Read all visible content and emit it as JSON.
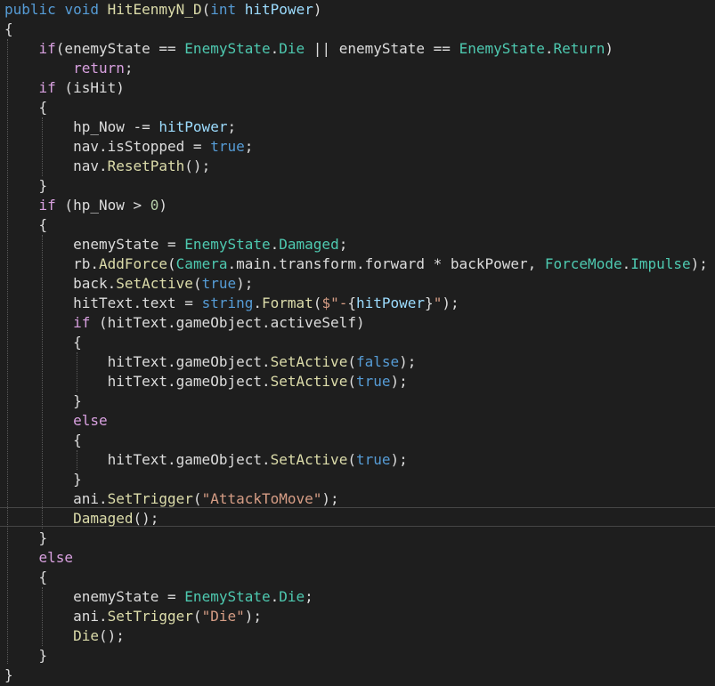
{
  "colors": {
    "background": "#1e1e1e",
    "plain": "#dcdcdc",
    "keyword": "#569cd6",
    "control": "#d8a0df",
    "type": "#4ec9b0",
    "method": "#dcdcaa",
    "string": "#d69d85",
    "number": "#b5cea8",
    "identifier": "#9cdcfe"
  },
  "code_lines": [
    [
      [
        "keyword",
        "public"
      ],
      [
        "plain",
        " "
      ],
      [
        "keyword",
        "void"
      ],
      [
        "plain",
        " "
      ],
      [
        "method",
        "HitEenmyN_D"
      ],
      [
        "plain",
        "("
      ],
      [
        "keyword",
        "int"
      ],
      [
        "plain",
        " "
      ],
      [
        "identifier",
        "hitPower"
      ],
      [
        "plain",
        ")"
      ]
    ],
    [
      [
        "plain",
        "{"
      ]
    ],
    [
      [
        "plain",
        "    "
      ],
      [
        "control",
        "if"
      ],
      [
        "plain",
        "(enemyState == "
      ],
      [
        "type",
        "EnemyState"
      ],
      [
        "plain",
        "."
      ],
      [
        "type",
        "Die"
      ],
      [
        "plain",
        " || enemyState == "
      ],
      [
        "type",
        "EnemyState"
      ],
      [
        "plain",
        "."
      ],
      [
        "type",
        "Return"
      ],
      [
        "plain",
        ")"
      ]
    ],
    [
      [
        "plain",
        "        "
      ],
      [
        "control",
        "return"
      ],
      [
        "plain",
        ";"
      ]
    ],
    [
      [
        "plain",
        "    "
      ],
      [
        "control",
        "if"
      ],
      [
        "plain",
        " (isHit)"
      ]
    ],
    [
      [
        "plain",
        "    {"
      ]
    ],
    [
      [
        "plain",
        "        hp_Now -= "
      ],
      [
        "identifier",
        "hitPower"
      ],
      [
        "plain",
        ";"
      ]
    ],
    [
      [
        "plain",
        "        nav.isStopped = "
      ],
      [
        "keyword",
        "true"
      ],
      [
        "plain",
        ";"
      ]
    ],
    [
      [
        "plain",
        "        nav."
      ],
      [
        "method",
        "ResetPath"
      ],
      [
        "plain",
        "();"
      ]
    ],
    [
      [
        "plain",
        "    }"
      ]
    ],
    [
      [
        "plain",
        "    "
      ],
      [
        "control",
        "if"
      ],
      [
        "plain",
        " (hp_Now > "
      ],
      [
        "number",
        "0"
      ],
      [
        "plain",
        ")"
      ]
    ],
    [
      [
        "plain",
        "    {"
      ]
    ],
    [
      [
        "plain",
        "        enemyState = "
      ],
      [
        "type",
        "EnemyState"
      ],
      [
        "plain",
        "."
      ],
      [
        "type",
        "Damaged"
      ],
      [
        "plain",
        ";"
      ]
    ],
    [
      [
        "plain",
        "        rb."
      ],
      [
        "method",
        "AddForce"
      ],
      [
        "plain",
        "("
      ],
      [
        "type",
        "Camera"
      ],
      [
        "plain",
        ".main.transform.forward * backPower, "
      ],
      [
        "type",
        "ForceMode"
      ],
      [
        "plain",
        "."
      ],
      [
        "type",
        "Impulse"
      ],
      [
        "plain",
        ");"
      ]
    ],
    [
      [
        "plain",
        "        back."
      ],
      [
        "method",
        "SetActive"
      ],
      [
        "plain",
        "("
      ],
      [
        "keyword",
        "true"
      ],
      [
        "plain",
        ");"
      ]
    ],
    [
      [
        "plain",
        "        hitText.text = "
      ],
      [
        "keyword",
        "string"
      ],
      [
        "plain",
        "."
      ],
      [
        "method",
        "Format"
      ],
      [
        "plain",
        "("
      ],
      [
        "string",
        "$\"-"
      ],
      [
        "plain",
        "{"
      ],
      [
        "identifier",
        "hitPower"
      ],
      [
        "plain",
        "}"
      ],
      [
        "string",
        "\""
      ],
      [
        "plain",
        ");"
      ]
    ],
    [
      [
        "plain",
        "        "
      ],
      [
        "control",
        "if"
      ],
      [
        "plain",
        " (hitText.gameObject.activeSelf)"
      ]
    ],
    [
      [
        "plain",
        "        {"
      ]
    ],
    [
      [
        "plain",
        "            hitText.gameObject."
      ],
      [
        "method",
        "SetActive"
      ],
      [
        "plain",
        "("
      ],
      [
        "keyword",
        "false"
      ],
      [
        "plain",
        ");"
      ]
    ],
    [
      [
        "plain",
        "            hitText.gameObject."
      ],
      [
        "method",
        "SetActive"
      ],
      [
        "plain",
        "("
      ],
      [
        "keyword",
        "true"
      ],
      [
        "plain",
        ");"
      ]
    ],
    [
      [
        "plain",
        "        }"
      ]
    ],
    [
      [
        "plain",
        "        "
      ],
      [
        "control",
        "else"
      ]
    ],
    [
      [
        "plain",
        "        {"
      ]
    ],
    [
      [
        "plain",
        "            hitText.gameObject."
      ],
      [
        "method",
        "SetActive"
      ],
      [
        "plain",
        "("
      ],
      [
        "keyword",
        "true"
      ],
      [
        "plain",
        ");"
      ]
    ],
    [
      [
        "plain",
        "        }"
      ]
    ],
    [
      [
        "plain",
        "        ani."
      ],
      [
        "method",
        "SetTrigger"
      ],
      [
        "plain",
        "("
      ],
      [
        "string",
        "\"AttackToMove\""
      ],
      [
        "plain",
        ");"
      ]
    ],
    [
      [
        "plain",
        "        "
      ],
      [
        "method",
        "Damaged"
      ],
      [
        "plain",
        "();"
      ]
    ],
    [
      [
        "plain",
        "    }"
      ]
    ],
    [
      [
        "plain",
        "    "
      ],
      [
        "control",
        "else"
      ]
    ],
    [
      [
        "plain",
        "    {"
      ]
    ],
    [
      [
        "plain",
        "        enemyState = "
      ],
      [
        "type",
        "EnemyState"
      ],
      [
        "plain",
        "."
      ],
      [
        "type",
        "Die"
      ],
      [
        "plain",
        ";"
      ]
    ],
    [
      [
        "plain",
        "        ani."
      ],
      [
        "method",
        "SetTrigger"
      ],
      [
        "plain",
        "("
      ],
      [
        "string",
        "\"Die\""
      ],
      [
        "plain",
        ");"
      ]
    ],
    [
      [
        "plain",
        "        "
      ],
      [
        "method",
        "Die"
      ],
      [
        "plain",
        "();"
      ]
    ],
    [
      [
        "plain",
        "    }"
      ]
    ],
    [
      [
        "plain",
        "}"
      ]
    ]
  ]
}
